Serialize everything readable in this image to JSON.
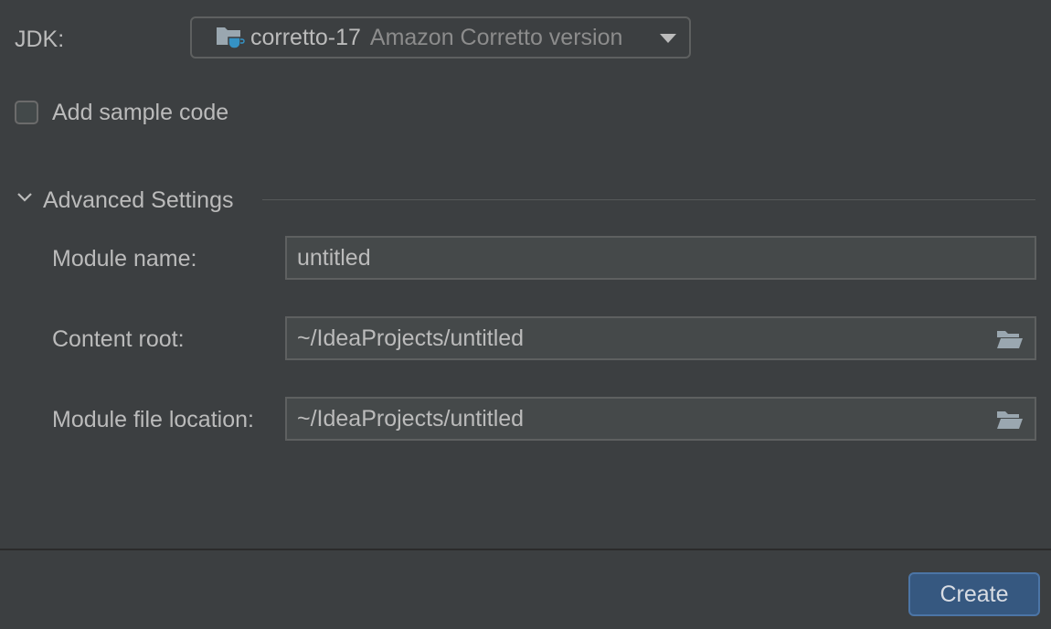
{
  "jdk": {
    "label": "JDK:",
    "selected_name": "corretto-17",
    "selected_version": "Amazon Corretto version",
    "icon": "jdk-folder-icon"
  },
  "sample_code": {
    "label": "Add sample code",
    "checked": false
  },
  "advanced": {
    "title": "Advanced Settings",
    "expanded": true,
    "module_name": {
      "label": "Module name:",
      "value": "untitled"
    },
    "content_root": {
      "label": "Content root:",
      "value": "~/IdeaProjects/untitled",
      "icon": "folder-open-icon"
    },
    "module_file_location": {
      "label": "Module file location:",
      "value": "~/IdeaProjects/untitled",
      "icon": "folder-open-icon"
    }
  },
  "footer": {
    "create_label": "Create"
  },
  "colors": {
    "background": "#3c3f41",
    "text": "#bbbbbb",
    "muted_text": "#8c8c8c",
    "field_background": "#45494a",
    "border": "#5e6060",
    "primary_button": "#365880",
    "jdk_icon_accent": "#3592c4"
  }
}
